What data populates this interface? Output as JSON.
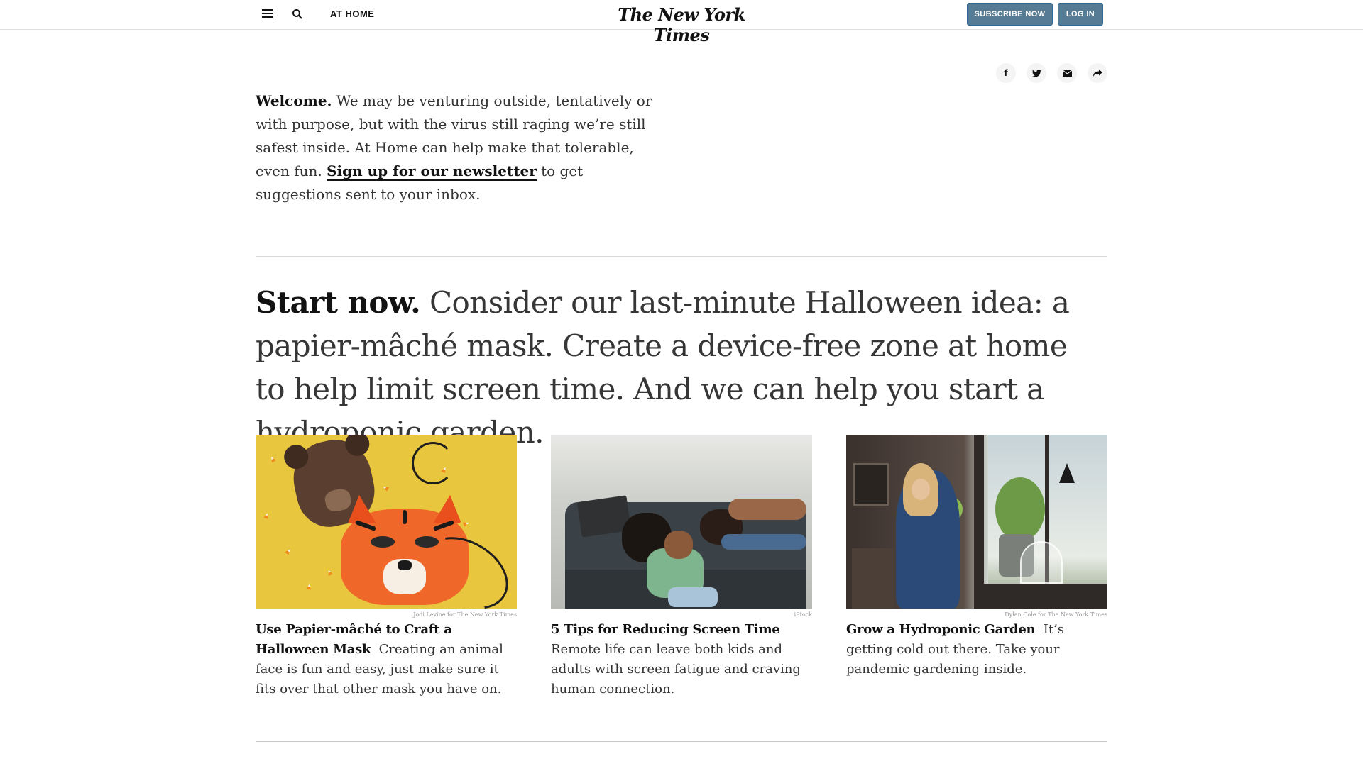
{
  "header": {
    "section": "AT HOME",
    "logo": "The New York Times",
    "subscribe_label": "SUBSCRIBE NOW",
    "login_label": "LOG IN"
  },
  "welcome": {
    "lead": "Welcome.",
    "body": " We may be venturing outside, tentatively or with purpose, but with the virus still raging we’re still safest inside. At Home can help make that tolerable, even fun. ",
    "link": "Sign up for our newsletter",
    "tail": " to get suggestions sent to your inbox."
  },
  "feature": {
    "lead": "Start now.",
    "body": " Consider our last-minute Halloween idea: a papier-mâché mask. Create a device-free zone at home to help limit screen time. And we can help you start a  hydroponic garden."
  },
  "cards": [
    {
      "credit": "Jodi Levine for The New York Times",
      "title": "Use Papier-mâché to Craft a Halloween Mask",
      "summary": "Creating an animal face is fun and easy, just make sure it fits over that other mask you have on."
    },
    {
      "credit": "iStock",
      "title": "5 Tips for Reducing Screen Time",
      "summary": "Remote life can leave both kids and adults with screen fatigue and craving human connection."
    },
    {
      "credit": "Dylan Cole for The New York Times",
      "title": "Grow a Hydroponic Garden",
      "summary": "It’s getting cold out there. Take your pandemic gardening inside."
    }
  ],
  "share_icons": [
    "facebook-icon",
    "twitter-icon",
    "email-icon",
    "share-arrow-icon"
  ],
  "colors": {
    "button_bg": "#567b95",
    "text": "#121212",
    "rule": "#dcdcdc"
  }
}
